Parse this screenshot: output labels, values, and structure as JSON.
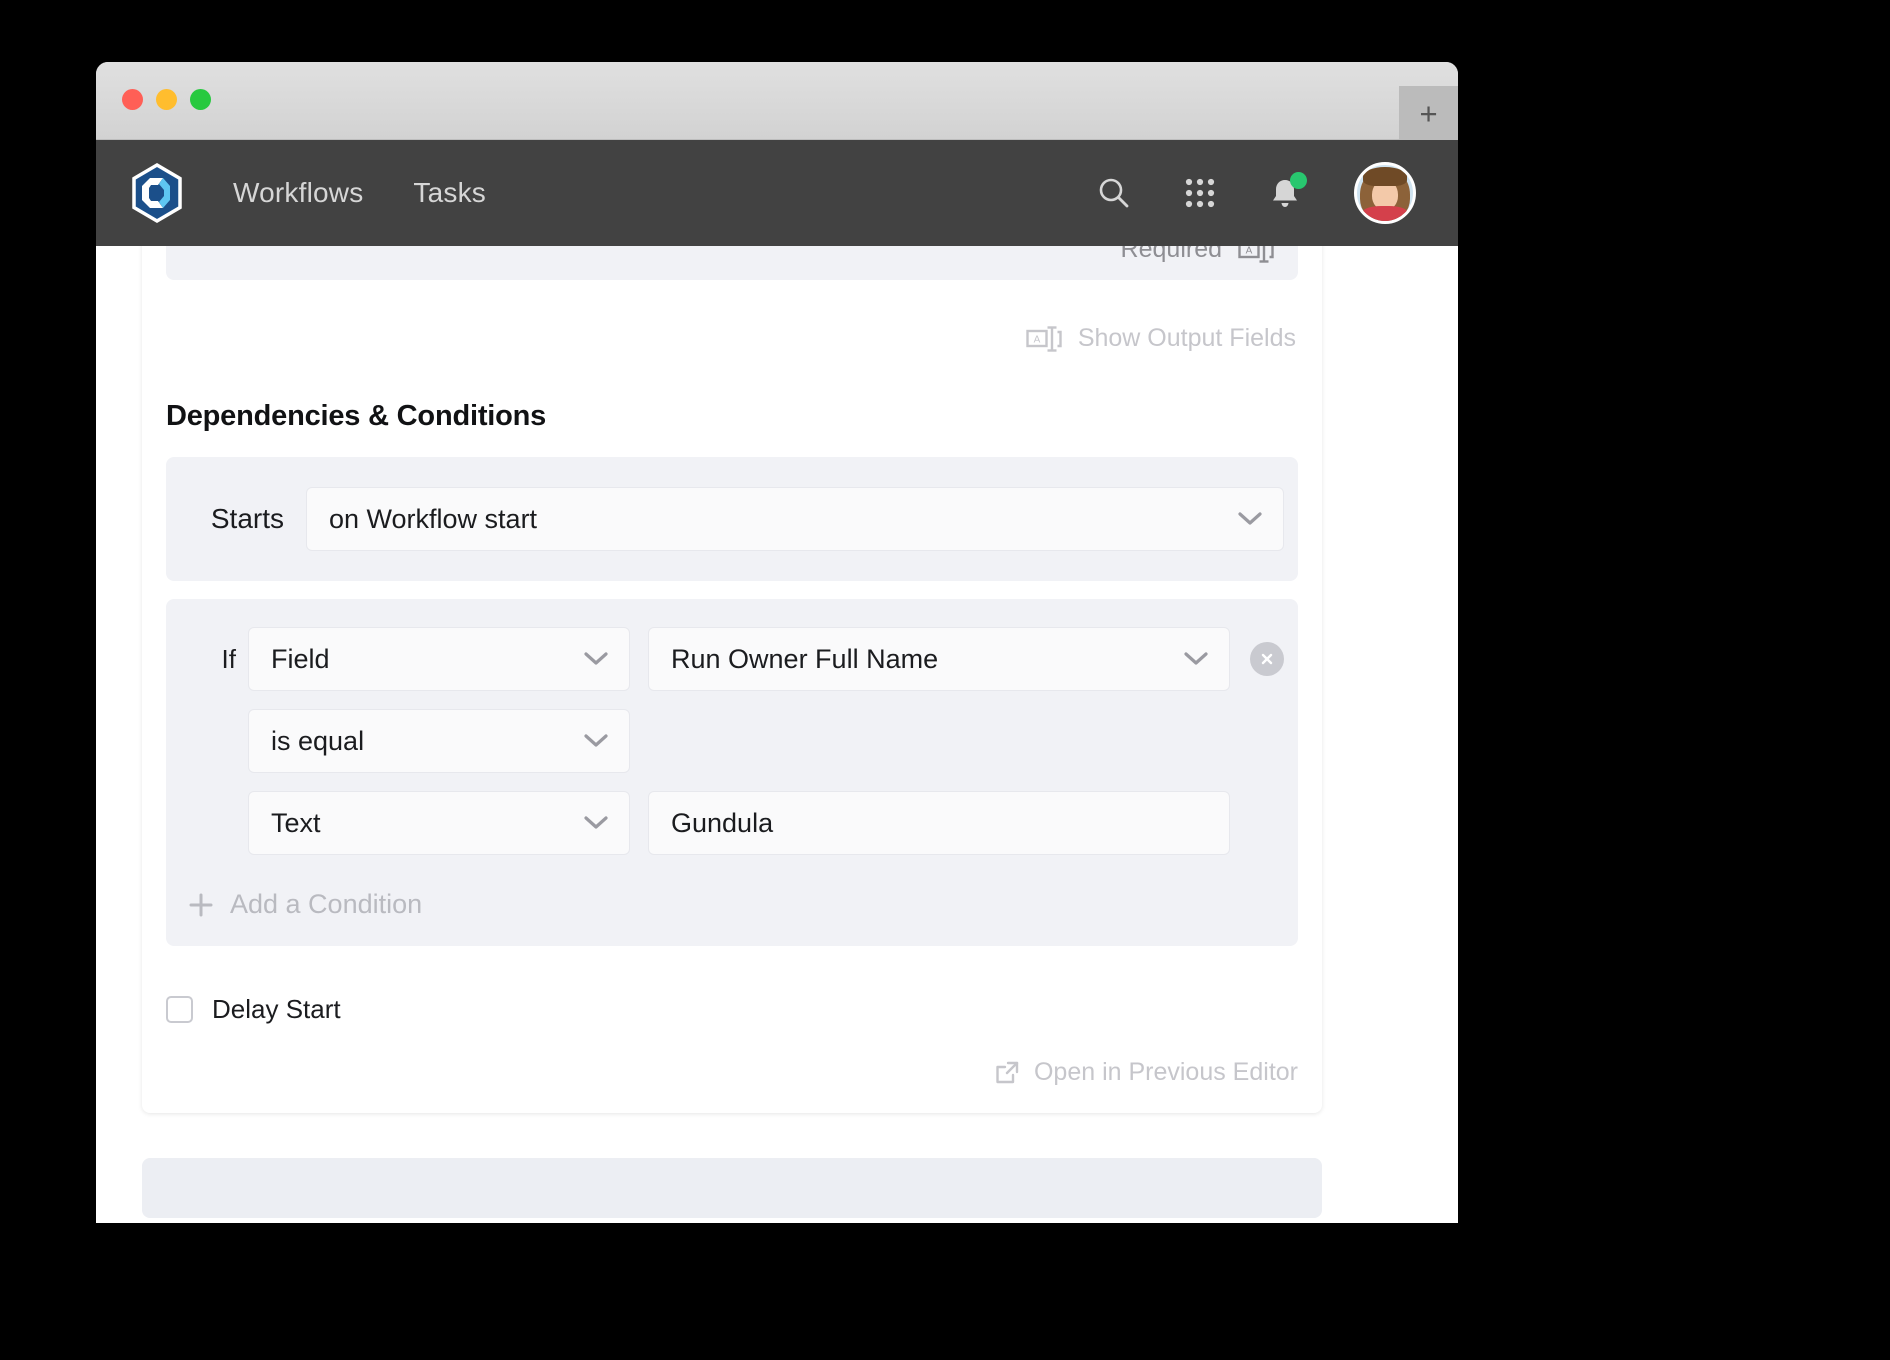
{
  "window": {
    "traffic_lights": [
      "close",
      "minimize",
      "maximize"
    ],
    "new_tab_label": "+"
  },
  "topnav": {
    "logo_name": "app-logo",
    "links": [
      {
        "label": "Workflows"
      },
      {
        "label": "Tasks"
      }
    ],
    "icons": [
      {
        "name": "search-icon"
      },
      {
        "name": "apps-grid-icon"
      },
      {
        "name": "notifications-bell-icon",
        "badge": true
      }
    ],
    "avatar_name": "user-avatar",
    "nav_bg": "#424242"
  },
  "form": {
    "required_label": "Required",
    "required_icon": "input-field-icon",
    "show_output_fields": {
      "label": "Show Output Fields",
      "icon": "input-field-icon"
    },
    "section_title": "Dependencies & Conditions",
    "starts": {
      "label": "Starts",
      "value": "on Workflow start",
      "icon": "chevron-down-icon"
    },
    "condition": {
      "if_label": "If",
      "subject_type": "Field",
      "subject_value": "Run Owner Full Name",
      "operator": "is equal",
      "value_type": "Text",
      "value": "Gundula",
      "remove_icon": "close-circle-icon"
    },
    "add_condition": {
      "label": "Add a Condition",
      "icon": "plus-icon"
    },
    "delay_start": {
      "label": "Delay Start",
      "checked": false
    },
    "open_previous_editor": {
      "label": "Open in Previous Editor",
      "icon": "external-link-icon"
    }
  },
  "colors": {
    "accent": "#1b4f8a",
    "panel_bg": "#f1f2f6",
    "input_bg": "#fafafb",
    "muted_text": "#c6c6cb",
    "badge_green": "#28c76f"
  }
}
